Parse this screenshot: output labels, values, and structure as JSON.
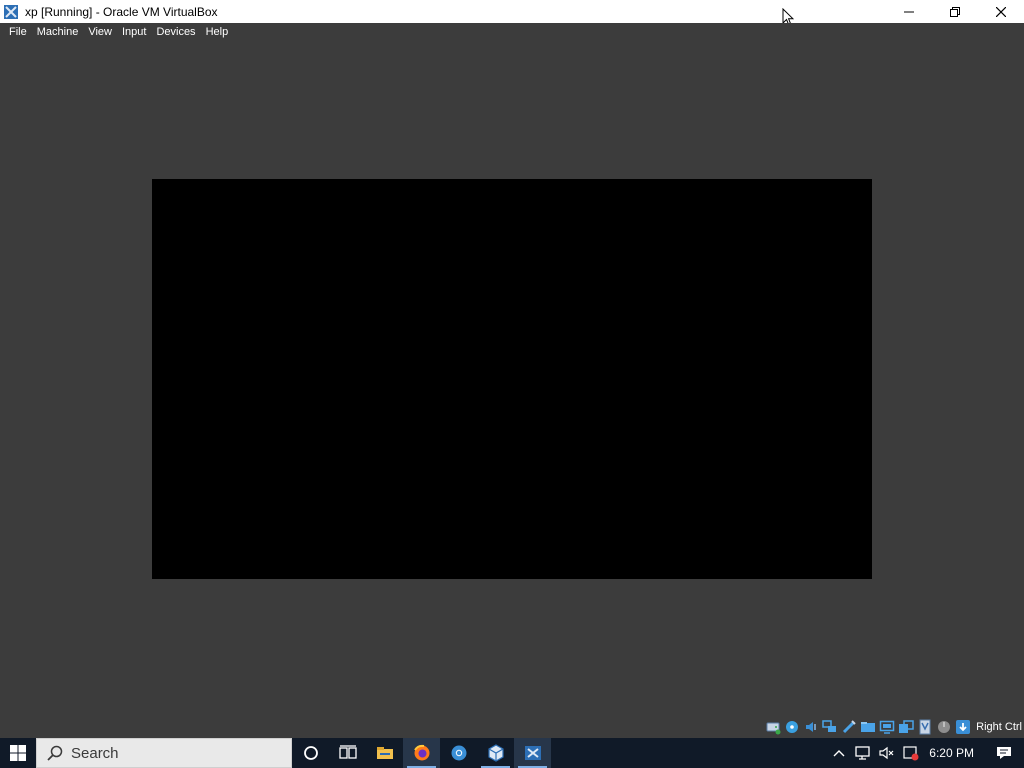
{
  "window": {
    "title": "xp [Running] - Oracle VM VirtualBox",
    "icons": [
      "virtualbox-app-icon",
      "minimize-icon",
      "restore-icon",
      "close-icon"
    ]
  },
  "menu": {
    "items": [
      {
        "label": "File"
      },
      {
        "label": "Machine"
      },
      {
        "label": "View"
      },
      {
        "label": "Input"
      },
      {
        "label": "Devices"
      },
      {
        "label": "Help"
      }
    ]
  },
  "vm": {
    "screen_color": "#000000",
    "background_color": "#3c3c3c"
  },
  "statusbar": {
    "host_key": "Right Ctrl",
    "icons": [
      "hard-disk-icon",
      "optical-drive-icon",
      "audio-icon",
      "network-icon",
      "usb-icon",
      "shared-folders-icon",
      "display-icon",
      "video-capture-icon",
      "virtualization-icon",
      "mouse-integration-icon",
      "keyboard-capture-icon"
    ]
  },
  "taskbar": {
    "search_placeholder": "Search",
    "apps": [
      "cortana-icon",
      "task-view-icon",
      "file-explorer-icon",
      "firefox-icon",
      "chrome-icon",
      "virtualbox-manager-icon",
      "virtualbox-vm-icon"
    ],
    "clock": "6:20 PM",
    "tray_icons": [
      "show-hidden-icons-chevron",
      "network-icon",
      "volume-muted-icon",
      "security-icon",
      "action-center-icon"
    ],
    "colors": {
      "background": "#101a28",
      "active": "#27364a"
    }
  }
}
